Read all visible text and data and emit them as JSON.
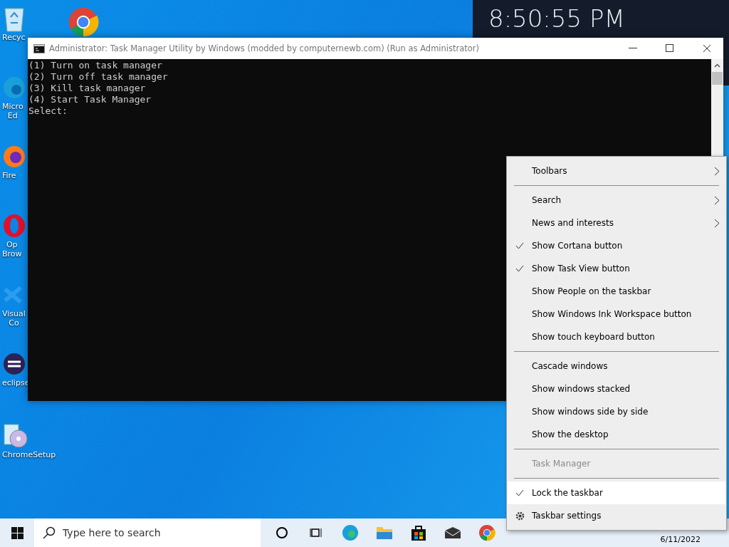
{
  "desktop": {
    "clock": "8:50:55 PM",
    "icons": [
      {
        "label": "Recyc",
        "kind": "recycle"
      },
      {
        "label": "Micro\nEd",
        "kind": "edge"
      },
      {
        "label": "Fire",
        "kind": "firefox"
      },
      {
        "label": "Op\nBrow",
        "kind": "opera"
      },
      {
        "label": "Visual\nCo",
        "kind": "vscode"
      },
      {
        "label": "eclipse",
        "kind": "eclipse"
      },
      {
        "label": "ChromeSetup",
        "kind": "setup"
      }
    ]
  },
  "console_window": {
    "title": "Administrator:  Task Manager Utility by Windows (modded by computernewb.com) (Run as Administrator)",
    "lines": [
      "(1) Turn on task manager",
      "(2) Turn off task manager",
      "(3) Kill task manager",
      "(4) Start Task Manager",
      "Select:"
    ]
  },
  "context_menu": [
    {
      "kind": "item",
      "label": "Toolbars",
      "submenu": true,
      "checked": false,
      "disabled": false,
      "selected": false
    },
    {
      "kind": "separator"
    },
    {
      "kind": "item",
      "label": "Search",
      "submenu": true,
      "checked": false,
      "disabled": false,
      "selected": false
    },
    {
      "kind": "item",
      "label": "News and interests",
      "submenu": true,
      "checked": false,
      "disabled": false,
      "selected": false
    },
    {
      "kind": "item",
      "label": "Show Cortana button",
      "submenu": false,
      "checked": true,
      "disabled": false,
      "selected": false
    },
    {
      "kind": "item",
      "label": "Show Task View button",
      "submenu": false,
      "checked": true,
      "disabled": false,
      "selected": false
    },
    {
      "kind": "item",
      "label": "Show People on the taskbar",
      "submenu": false,
      "checked": false,
      "disabled": false,
      "selected": false
    },
    {
      "kind": "item",
      "label": "Show Windows Ink Workspace button",
      "submenu": false,
      "checked": false,
      "disabled": false,
      "selected": false
    },
    {
      "kind": "item",
      "label": "Show touch keyboard button",
      "submenu": false,
      "checked": false,
      "disabled": false,
      "selected": false
    },
    {
      "kind": "separator"
    },
    {
      "kind": "item",
      "label": "Cascade windows",
      "submenu": false,
      "checked": false,
      "disabled": false,
      "selected": false
    },
    {
      "kind": "item",
      "label": "Show windows stacked",
      "submenu": false,
      "checked": false,
      "disabled": false,
      "selected": false
    },
    {
      "kind": "item",
      "label": "Show windows side by side",
      "submenu": false,
      "checked": false,
      "disabled": false,
      "selected": false
    },
    {
      "kind": "item",
      "label": "Show the desktop",
      "submenu": false,
      "checked": false,
      "disabled": false,
      "selected": false
    },
    {
      "kind": "separator"
    },
    {
      "kind": "item",
      "label": "Task Manager",
      "submenu": false,
      "checked": false,
      "disabled": true,
      "selected": false
    },
    {
      "kind": "separator"
    },
    {
      "kind": "item",
      "label": "Lock the taskbar",
      "submenu": false,
      "checked": true,
      "disabled": false,
      "selected": true
    },
    {
      "kind": "gear",
      "label": "Taskbar settings",
      "submenu": false,
      "checked": false,
      "disabled": false,
      "selected": false
    }
  ],
  "taskbar": {
    "search": {
      "placeholder": "Type here to search"
    },
    "apps": [
      {
        "kind": "cortana"
      },
      {
        "kind": "taskview"
      },
      {
        "kind": "edge"
      },
      {
        "kind": "explorer"
      },
      {
        "kind": "store"
      },
      {
        "kind": "mail"
      },
      {
        "kind": "chrome"
      }
    ],
    "date": "6/11/2022"
  }
}
